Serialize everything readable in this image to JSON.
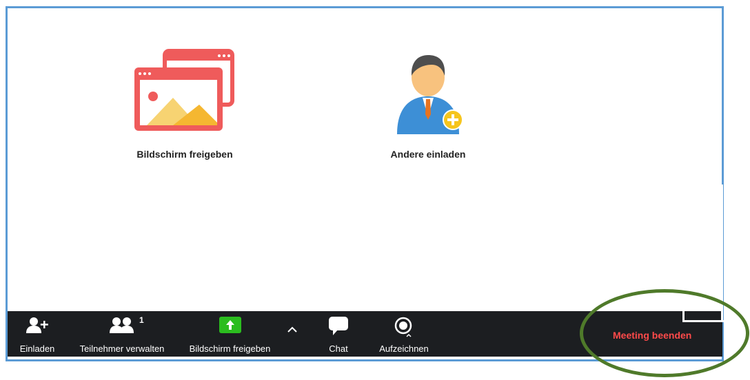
{
  "main": {
    "share_tile": {
      "label": "Bildschirm freigeben",
      "icon": "share-screen-icon"
    },
    "invite_tile": {
      "label": "Andere einladen",
      "icon": "invite-user-icon"
    }
  },
  "toolbar": {
    "items": [
      {
        "label": "Einladen",
        "icon": "add-user-icon"
      },
      {
        "label": "Teilnehmer verwalten",
        "icon": "participants-icon",
        "badge": "1"
      },
      {
        "label": "Bildschirm freigeben",
        "icon": "share-arrow-icon"
      },
      {
        "label": "Chat",
        "icon": "chat-bubble-icon"
      },
      {
        "label": "Aufzeichnen",
        "icon": "record-icon"
      }
    ],
    "end_meeting": "Meeting beenden"
  },
  "colors": {
    "accent_red": "#ff4a4a",
    "share_green": "#2bbd1f",
    "toolbar_bg": "#1c1e21",
    "window_border": "#5b9bd5",
    "annotation_green": "#4f7a2a"
  }
}
